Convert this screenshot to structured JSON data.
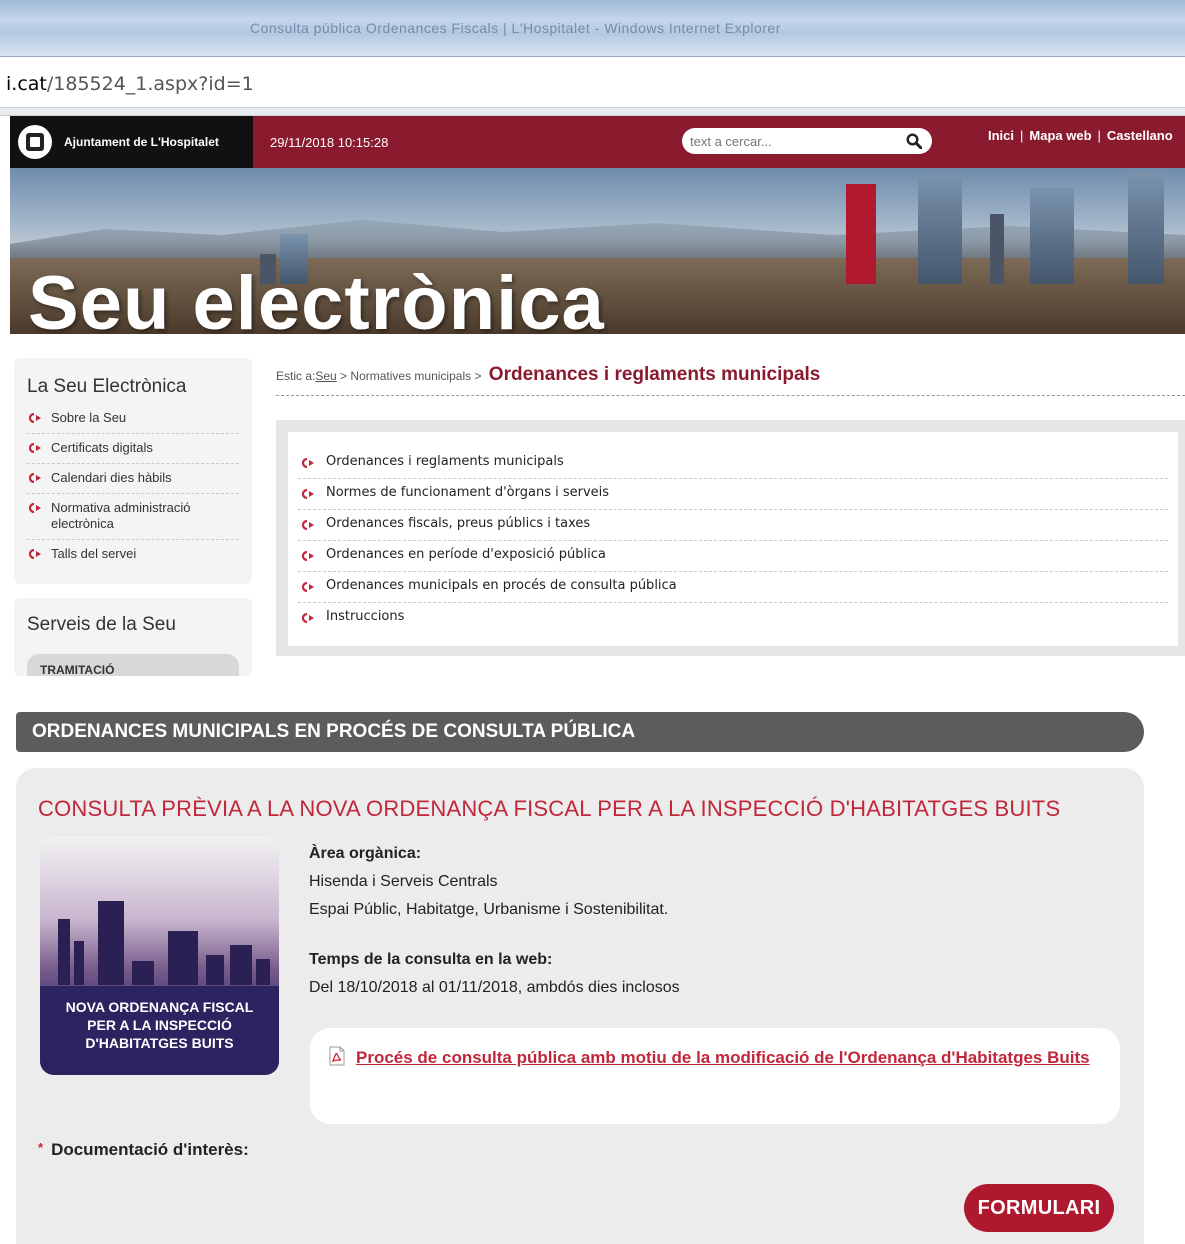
{
  "browser": {
    "title": "Consulta pública Ordenances Fiscals | L'Hospitalet - Windows Internet Explorer",
    "url_domain": "i.cat",
    "url_path": "/185524_1.aspx?id=1"
  },
  "header": {
    "logo_text": "Ajuntament de L'Hospitalet",
    "datetime": "29/11/2018 10:15:28",
    "search_placeholder": "text a cercar...",
    "links": [
      "Inici",
      "Mapa web",
      "Castellano"
    ]
  },
  "banner": {
    "title": "Seu electrònica"
  },
  "sidebar": {
    "box1_title": "La Seu Electrònica",
    "items": [
      "Sobre la Seu",
      "Certificats digitals",
      "Calendari dies hàbils",
      "Normativa administració electrònica",
      "Talls del servei"
    ],
    "box2_title": "Serveis de la Seu",
    "tramitacio": "TRAMITACIÓ"
  },
  "breadcrumb": {
    "prefix": "Estic a:",
    "seu": "Seu",
    "sep1": " > ",
    "normatives": "Normatives municipals",
    "sep2": " > ",
    "current": "Ordenances i reglaments municipals"
  },
  "links": [
    "Ordenances i reglaments municipals",
    "Normes de funcionament d'òrgans i serveis",
    "Ordenances fiscals, preus públics i taxes",
    "Ordenances en període d'exposició pública",
    "Ordenances municipals en procés de consulta pública",
    "Instruccions"
  ],
  "section": {
    "title": "ORDENANCES MUNICIPALS EN PROCÉS DE CONSULTA PÚBLICA"
  },
  "card": {
    "title": "CONSULTA PRÈVIA A LA NOVA ORDENANÇA FISCAL PER A LA INSPECCIÓ D'HABITATGES BUITS",
    "thumb_line1": "NOVA ORDENANÇA FISCAL",
    "thumb_line2": "PER A LA INSPECCIÓ",
    "thumb_line3": "D'HABITATGES BUITS",
    "area_label": "Àrea orgànica:",
    "area_line1": "Hisenda i Serveis Centrals",
    "area_line2": "Espai Públic, Habitatge, Urbanisme i Sostenibilitat.",
    "time_label": "Temps de la consulta en la web:",
    "time_value": "Del 18/10/2018 al 01/11/2018, ambdós dies inclosos",
    "doc_link": "Procés de consulta pública amb motiu de la modificació de l'Ordenança d'Habitatges Buits",
    "docint_star": "*",
    "docint_label": "Documentació d'interès:",
    "form_button": "FORMULARI"
  },
  "colors": {
    "brand": "#8a1b2f",
    "accent_red": "#c0273a",
    "section_gray": "#5c5c5c"
  }
}
